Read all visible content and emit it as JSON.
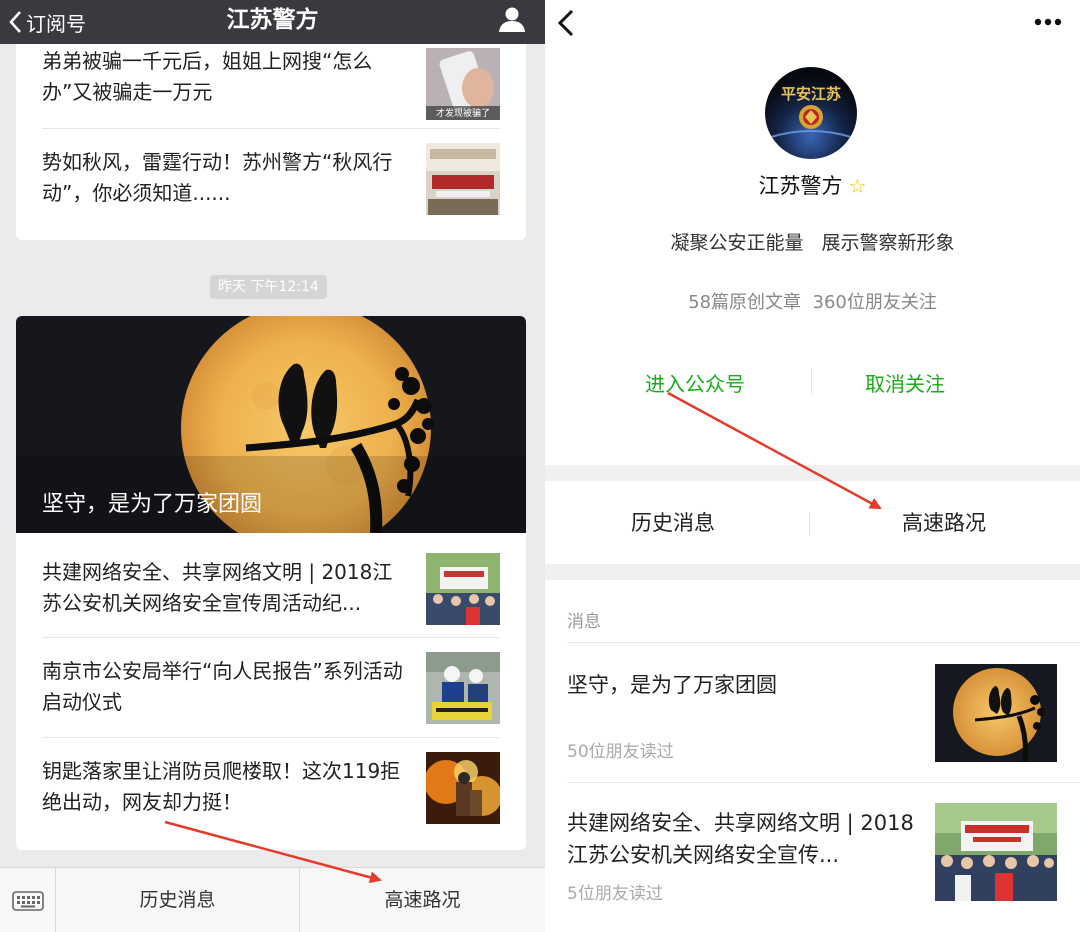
{
  "left": {
    "navbar": {
      "back_label": "订阅号",
      "title": "江苏警方"
    },
    "card1": {
      "articles": [
        {
          "title": "弟弟被骗一千元后，姐姐上网搜“怎么办”又被骗走一万元",
          "thumb_caption": "才发现被骗了"
        },
        {
          "title": "势如秋风，雷霆行动！苏州警方“秋风行动”，你必须知道......"
        }
      ]
    },
    "timestamp": "昨天 下午12:14",
    "card2": {
      "hero_title": "坚守，是为了万家团圆",
      "articles": [
        {
          "title": "共建网络安全、共享网络文明 | 2018江苏公安机关网络安全宣传周活动纪..."
        },
        {
          "title": "南京市公安局举行“向人民报告”系列活动启动仪式"
        },
        {
          "title": "钥匙落家里让消防员爬楼取！这次119拒绝出动，网友却力挺！"
        }
      ]
    },
    "bottom_menu": {
      "item1": "历史消息",
      "item2": "高速路况"
    }
  },
  "right": {
    "avatar_text": "平安江苏",
    "account_name": "江苏警方",
    "slogan": "凝聚公安正能量   展示警察新形象",
    "stats": "58篇原创文章  360位朋友关注",
    "actions": {
      "enter": "进入公众号",
      "unfollow": "取消关注"
    },
    "menu": {
      "item1": "历史消息",
      "item2": "高速路况"
    },
    "section_label": "消息",
    "messages": [
      {
        "title": "坚守，是为了万家团圆",
        "reads": "50位朋友读过"
      },
      {
        "title": "共建网络安全、共享网络文明 | 2018江苏公安机关网络安全宣传...",
        "reads": "5位朋友读过"
      }
    ]
  },
  "colors": {
    "accent_green": "#1aad19",
    "navbar": "#393a3f",
    "arrow_red": "#e53b2c"
  }
}
